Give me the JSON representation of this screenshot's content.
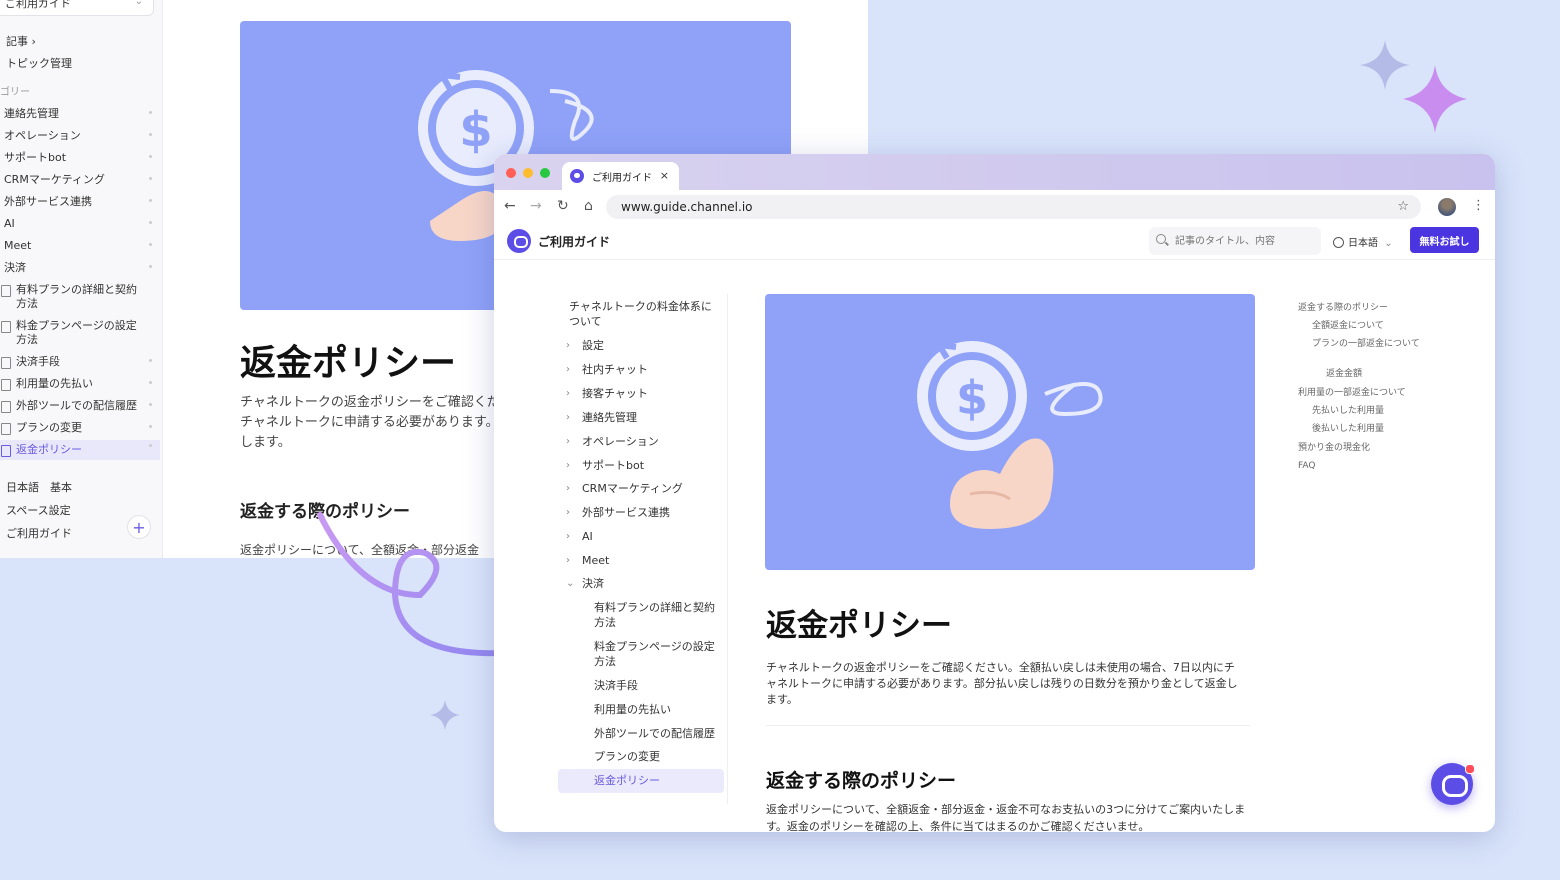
{
  "bg_window": {
    "space_select": "ご利用ガイド",
    "links": [
      "記事 ›",
      "トピック管理"
    ],
    "section_label": "ゴリー",
    "categories": [
      "連絡先管理",
      "オペレーション",
      "サポートbot",
      "CRMマーケティング",
      "外部サービス連携",
      "AI",
      "Meet",
      "決済"
    ],
    "docs": [
      "有料プランの詳細と契約方法",
      "料金プランページの設定方法",
      "決済手段",
      "利用量の先払い",
      "外部ツールでの配信履歴",
      "プランの変更",
      "返金ポリシー"
    ],
    "lang_row": "日本語　基本",
    "space_settings": "スペース設定",
    "guide": "ご利用ガイド",
    "add_icon": "+",
    "title": "返金ポリシー",
    "desc": "チャネルトークの返金ポリシーをご確認くだ チャネルトークに申請する必要があります。 します。",
    "h2": "返金する際のポリシー",
    "body": "返金ポリシーについて、全額返金・部分返金"
  },
  "browser": {
    "tab_title": "ご利用ガイド",
    "tab_close": "×",
    "url": "www.guide.channel.io",
    "nav_icons": {
      "back": "←",
      "forward": "→",
      "reload": "↻",
      "home": "⌂",
      "star": "☆",
      "kebab": "⋮"
    },
    "site_name": "ご利用ガイド",
    "search_placeholder": "記事のタイトル、内容",
    "language": "日本語",
    "language_chevron": "⌄",
    "trial_button": "無料お試し",
    "left_nav": {
      "intro": "チャネルトークの料金体系について",
      "items": [
        "設定",
        "社内チャット",
        "接客チャット",
        "連絡先管理",
        "オペレーション",
        "サポートbot",
        "CRMマーケティング",
        "外部サービス連携",
        "AI",
        "Meet"
      ],
      "expanded": "決済",
      "arrow_closed": "›",
      "arrow_open": "⌄",
      "sub_items": [
        "有料プランの詳細と契約方法",
        "料金プランページの設定方法",
        "決済手段",
        "利用量の先払い",
        "外部ツールでの配信履歴",
        "プランの変更"
      ],
      "active": "返金ポリシー"
    },
    "article": {
      "title": "返金ポリシー",
      "desc": "チャネルトークの返金ポリシーをご確認ください。全額払い戻しは未使用の場合、7日以内にチャネルトークに申請する必要があります。部分払い戻しは残りの日数分を預かり金として返金します。",
      "h2": "返金する際のポリシー",
      "body": "返金ポリシーについて、全額返金・部分返金・返金不可なお支払いの3つに分けてご案内いたします。返金のポリシーを確認の上、条件に当てはまるのかご確認くださいませ。"
    },
    "toc": [
      "返金する際のポリシー",
      "全額返金について",
      "プランの一部返金について",
      "返金金額",
      "利用量の一部返金について",
      "先払いした利用量",
      "後払いした利用量",
      "預かり金の現金化",
      "FAQ"
    ]
  },
  "colors": {
    "accent": "#5b4de6",
    "hero": "#8fa2f8",
    "background": "#d9e4fb",
    "active_bg": "#ebeafd"
  }
}
